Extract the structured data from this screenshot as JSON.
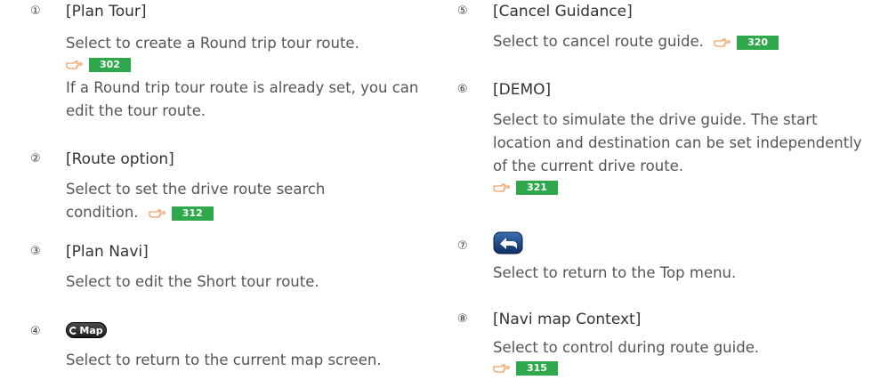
{
  "items": [
    {
      "num": "①",
      "title": "[Plan Tour]",
      "body1": "Select to create a Round trip tour route.",
      "ref": "302",
      "body2": "If a Round trip tour route is already set, you can edit the tour route."
    },
    {
      "num": "②",
      "title": "[Route option]",
      "body": "Select to set the drive route search condition.",
      "ref": "312"
    },
    {
      "num": "③",
      "title": "[Plan Navi]",
      "body": "Select to edit the Short tour route."
    },
    {
      "num": "④",
      "icon": "map-button-icon",
      "icon_text": "Map",
      "body": "Select to return to the current map screen."
    },
    {
      "num": "⑤",
      "title": "[Cancel Guidance]",
      "body": "Select to cancel route guide.",
      "ref": "320"
    },
    {
      "num": "⑥",
      "title": "[DEMO]",
      "body": "Select to simulate the drive guide. The start location and destination can be set independently of the current drive route.",
      "ref": "321"
    },
    {
      "num": "⑦",
      "icon": "return-arrow-icon",
      "body": "Select to return to the Top menu."
    },
    {
      "num": "⑧",
      "title": "[Navi map Context]",
      "body": "Select to control during route guide.",
      "ref": "315"
    }
  ],
  "colors": {
    "badge": "#2ea84a",
    "text": "#555555"
  }
}
